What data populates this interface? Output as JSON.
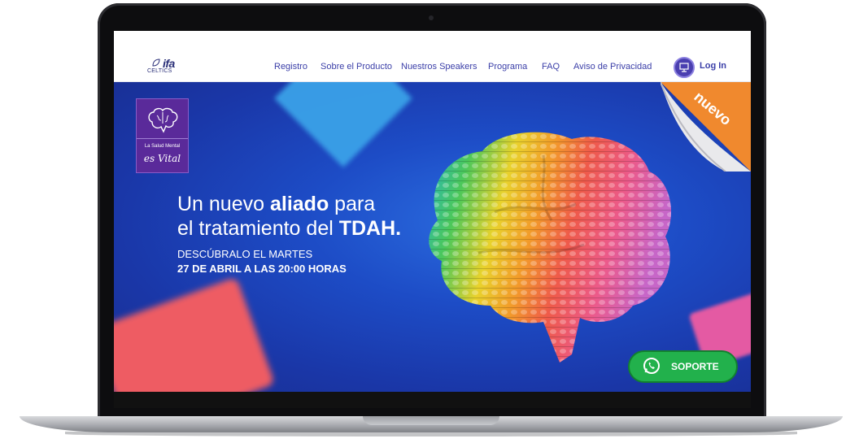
{
  "logo": {
    "brand": "ifa",
    "sub": "CELTICS"
  },
  "nav": {
    "items": [
      {
        "label": "Registro"
      },
      {
        "label": "Sobre el Producto"
      },
      {
        "label": "Nuestros Speakers"
      },
      {
        "label": "Programa"
      },
      {
        "label": "FAQ"
      },
      {
        "label": "Aviso de Privacidad"
      }
    ],
    "login_label": "Log In"
  },
  "badge": {
    "line1": "La Salud Mental",
    "line2": "es Vital"
  },
  "hero": {
    "headline_pre1": "Un nuevo ",
    "headline_bold1": "aliado",
    "headline_post1": " para",
    "headline_pre2": "el tratamiento del ",
    "headline_bold2": "TDAH.",
    "date_line1": "DESCÚBRALO EL MARTES",
    "date_line2": "27 DE ABRIL A LAS 20:00 HORAS"
  },
  "ribbon": {
    "text": "nuevo"
  },
  "support": {
    "label": "SOPORTE"
  },
  "colors": {
    "hero_blue": "#1d4cc6",
    "nav_link": "#3b3fa8",
    "badge_purple": "#5a2a9a",
    "ribbon_orange": "#f0892e",
    "whatsapp_green": "#22b14c"
  },
  "icons": [
    "leaf-icon",
    "user-icon",
    "brain-icon",
    "whatsapp-icon"
  ]
}
